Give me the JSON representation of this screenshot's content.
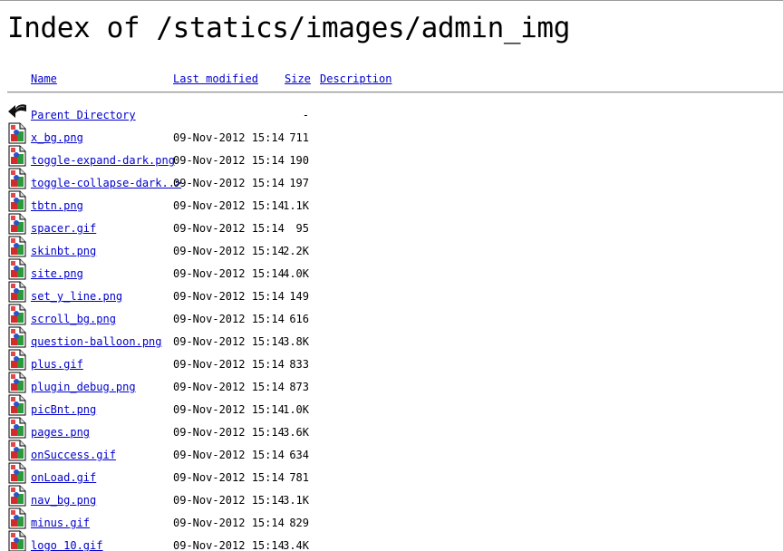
{
  "page": {
    "title": "Index of /statics/images/admin_img"
  },
  "columns": {
    "name": "Name",
    "last_modified": "Last modified",
    "size": "Size",
    "description": "Description"
  },
  "parent": {
    "label": "Parent Directory",
    "size": "-",
    "icon": "back-arrow-icon"
  },
  "entries": [
    {
      "name": "x_bg.png",
      "date": "09-Nov-2012 15:14",
      "size": "711",
      "icon": "image-file-icon"
    },
    {
      "name": "toggle-expand-dark.png",
      "date": "09-Nov-2012 15:14",
      "size": "190",
      "icon": "image-file-icon"
    },
    {
      "name": "toggle-collapse-dark..>",
      "date": "09-Nov-2012 15:14",
      "size": "197",
      "icon": "image-file-icon"
    },
    {
      "name": "tbtn.png",
      "date": "09-Nov-2012 15:14",
      "size": "1.1K",
      "icon": "image-file-icon"
    },
    {
      "name": "spacer.gif",
      "date": "09-Nov-2012 15:14",
      "size": "95",
      "icon": "image-file-icon"
    },
    {
      "name": "skinbt.png",
      "date": "09-Nov-2012 15:14",
      "size": "2.2K",
      "icon": "image-file-icon"
    },
    {
      "name": "site.png",
      "date": "09-Nov-2012 15:14",
      "size": "4.0K",
      "icon": "image-file-icon"
    },
    {
      "name": "set_y_line.png",
      "date": "09-Nov-2012 15:14",
      "size": "149",
      "icon": "image-file-icon"
    },
    {
      "name": "scroll_bg.png",
      "date": "09-Nov-2012 15:14",
      "size": "616",
      "icon": "image-file-icon"
    },
    {
      "name": "question-balloon.png",
      "date": "09-Nov-2012 15:14",
      "size": "3.8K",
      "icon": "image-file-icon"
    },
    {
      "name": "plus.gif",
      "date": "09-Nov-2012 15:14",
      "size": "833",
      "icon": "image-file-icon"
    },
    {
      "name": "plugin_debug.png",
      "date": "09-Nov-2012 15:14",
      "size": "873",
      "icon": "image-file-icon"
    },
    {
      "name": "picBnt.png",
      "date": "09-Nov-2012 15:14",
      "size": "1.0K",
      "icon": "image-file-icon"
    },
    {
      "name": "pages.png",
      "date": "09-Nov-2012 15:14",
      "size": "3.6K",
      "icon": "image-file-icon"
    },
    {
      "name": "onSuccess.gif",
      "date": "09-Nov-2012 15:14",
      "size": "634",
      "icon": "image-file-icon"
    },
    {
      "name": "onLoad.gif",
      "date": "09-Nov-2012 15:14",
      "size": "781",
      "icon": "image-file-icon"
    },
    {
      "name": "nav_bg.png",
      "date": "09-Nov-2012 15:14",
      "size": "3.1K",
      "icon": "image-file-icon"
    },
    {
      "name": "minus.gif",
      "date": "09-Nov-2012 15:14",
      "size": "829",
      "icon": "image-file-icon"
    },
    {
      "name": "logo_10.gif",
      "date": "09-Nov-2012 15:14",
      "size": "3.4K",
      "icon": "image-file-icon"
    }
  ]
}
